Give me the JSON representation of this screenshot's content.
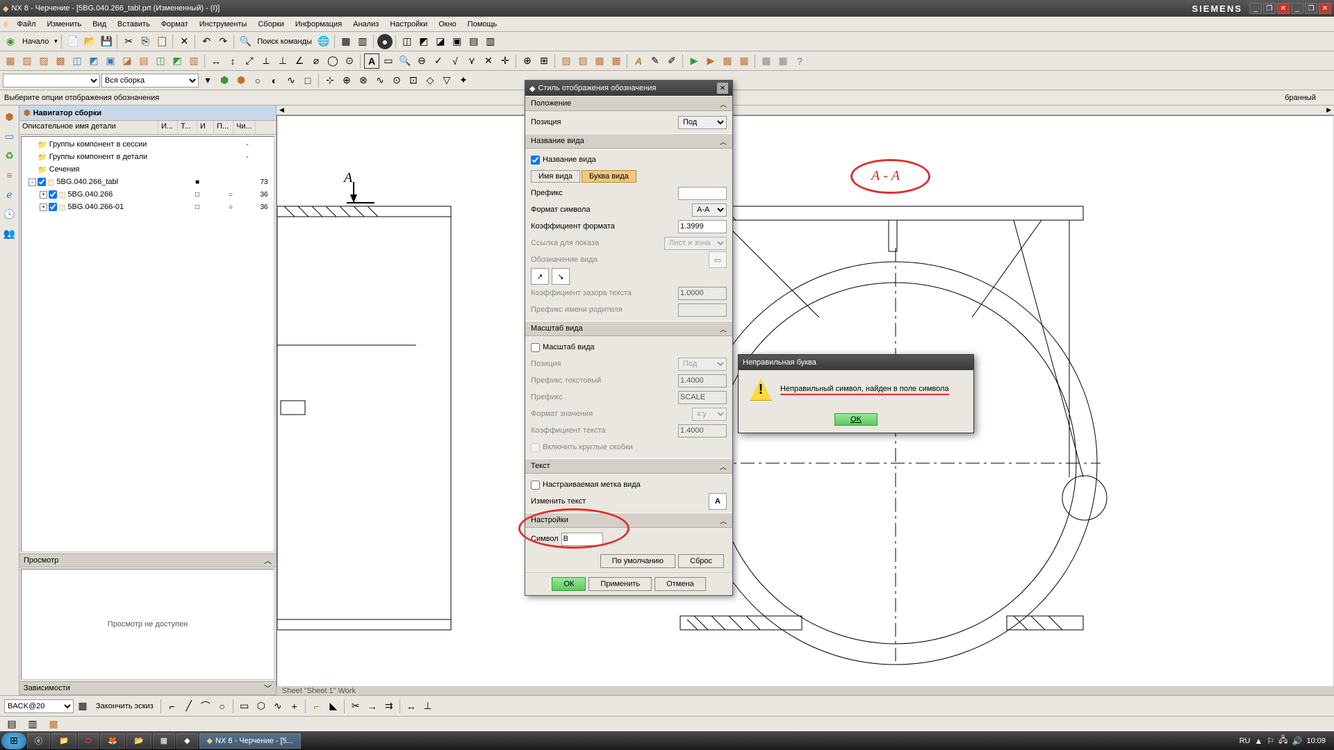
{
  "title": "NX 8 - Черчение - [5BG.040.266_tabl.prt (Измененный) - (I)]",
  "brand": "SIEMENS",
  "menu": [
    "Файл",
    "Изменить",
    "Вид",
    "Вставить",
    "Формат",
    "Инструменты",
    "Сборки",
    "Информация",
    "Анализ",
    "Настройки",
    "Окно",
    "Помощь"
  ],
  "toolbar1": {
    "start": "Начало",
    "search": "Поиск команды"
  },
  "combo_assembly": "Вся сборка",
  "prompt": "Выберите опции отображения обозначения",
  "prompt_right": "бранный",
  "navigator": {
    "title": "Навигатор сборки",
    "columns": [
      "Описательное имя детали",
      "И...",
      "Т...",
      "И",
      "П...",
      "Чи..."
    ],
    "rows": [
      {
        "indent": 0,
        "exp": "",
        "folder": true,
        "label": "Группы компонент в сессии",
        "cells": [
          "",
          "",
          "",
          "",
          "-",
          ""
        ]
      },
      {
        "indent": 0,
        "exp": "",
        "folder": true,
        "label": "Группы компонент в детали",
        "cells": [
          "",
          "",
          "",
          "",
          "-",
          ""
        ]
      },
      {
        "indent": 0,
        "exp": "",
        "folder": true,
        "label": "Сечения",
        "cells": [
          "",
          "",
          "",
          "",
          "",
          ""
        ]
      },
      {
        "indent": 0,
        "exp": "-",
        "chk": true,
        "part": true,
        "label": "5BG.040.266_tabl",
        "cells": [
          "",
          "■",
          "",
          "",
          "",
          "73"
        ]
      },
      {
        "indent": 1,
        "exp": "+",
        "chk": true,
        "part": true,
        "label": "5BG.040.266",
        "cells": [
          "",
          "□",
          "",
          "○",
          "",
          "36"
        ]
      },
      {
        "indent": 1,
        "exp": "+",
        "chk": true,
        "part": true,
        "label": "5BG.040.266-01",
        "cells": [
          "",
          "□",
          "",
          "○",
          "",
          "36"
        ]
      }
    ],
    "preview_hdr": "Просмотр",
    "preview_text": "Просмотр не доступен",
    "deps_hdr": "Зависимости"
  },
  "sheet_label": "Sheet \"Sheet 1\" Work",
  "drawing_label_A": "А",
  "drawing_label_AA": "А - А",
  "dialog": {
    "title": "Стиль отображения обозначения",
    "sec_position": "Положение",
    "lbl_position": "Позиция",
    "val_position": "Под",
    "sec_viewname": "Название вида",
    "chk_viewname": "Название вида",
    "btn_name": "Имя вида",
    "btn_letter": "Буква вида",
    "lbl_prefix": "Префикс",
    "val_prefix": "",
    "lbl_format": "Формат символа",
    "val_format": "A-A",
    "lbl_coef": "Коэффициент формата",
    "val_coef": "1.3999",
    "lbl_ref": "Ссылка для показа",
    "val_ref": "Лист и зона",
    "lbl_desig": "Обозначение вида",
    "lbl_textgap": "Коэффициент зазора текста",
    "val_textgap": "1.0000",
    "lbl_parentprefix": "Префикс имени родителя",
    "sec_scale": "Масштаб вида",
    "chk_scale": "Масштаб вида",
    "lbl_scalepos": "Позиция",
    "val_scalepos": "Под",
    "lbl_textprefix": "Префикс текстовый",
    "val_textprefix": "1.4000",
    "lbl_prefix2": "Префикс",
    "val_prefix2": "SCALE",
    "lbl_valformat": "Формат значения",
    "val_valformat": "x:y",
    "lbl_textcoef": "Коэффициент текста",
    "val_textcoef": "1.4000",
    "chk_brackets": "Включить круглые скобки",
    "sec_text": "Текст",
    "chk_custom": "Настраиваемая метка вида",
    "lbl_edit": "Изменить текст",
    "sec_settings": "Настройки",
    "lbl_symbol": "Символ",
    "val_symbol": "В",
    "btn_default": "По умолчанию",
    "btn_reset": "Сброс",
    "btn_ok": "ОК",
    "btn_apply": "Применить",
    "btn_cancel": "Отмена"
  },
  "msgbox": {
    "title": "Неправильная буква",
    "text": "Неправильный символ, найден в поле символа",
    "ok": "OK"
  },
  "sketch_toolbar": {
    "combo": "BACK@20",
    "finish": "Закончить эскиз"
  },
  "taskbar": {
    "items": [
      "",
      "",
      "",
      "",
      "",
      "",
      ""
    ],
    "active": "NX 8 - Черчение - [5...",
    "lang": "RU",
    "time": "10:09"
  }
}
